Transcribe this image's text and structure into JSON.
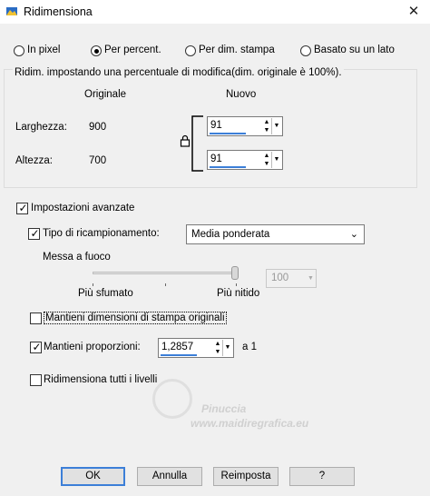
{
  "window": {
    "title": "Ridimensiona"
  },
  "modes": [
    {
      "label": "In pixel",
      "selected": false
    },
    {
      "label": "Per percent.",
      "selected": true
    },
    {
      "label": "Per dim. stampa",
      "selected": false
    },
    {
      "label": "Basato su un lato",
      "selected": false
    }
  ],
  "group": {
    "caption": "Ridim. impostando una percentuale di modifica(dim. originale è 100%).",
    "col_original": "Originale",
    "col_new": "Nuovo",
    "width_label": "Larghezza:",
    "width_original": "900",
    "width_new": "91",
    "height_label": "Altezza:",
    "height_original": "700",
    "height_new": "91"
  },
  "advanced": {
    "label": "Impostazioni avanzate",
    "checked": true,
    "resample_label": "Tipo di ricampionamento:",
    "resample_checked": true,
    "resample_value": "Media ponderata",
    "sharpen_label": "Messa a fuoco",
    "sharpen_left": "Più sfumato",
    "sharpen_right": "Più nitido",
    "sharpen_value": "100",
    "keep_print_label": "Mantieni dimensioni di stampa originali",
    "keep_print_checked": false,
    "keep_ratio_label": "Mantieni proporzioni:",
    "keep_ratio_checked": true,
    "ratio_value": "1,2857",
    "ratio_suffix": "a 1",
    "all_layers_label": "Ridimensiona tutti i livelli",
    "all_layers_checked": false
  },
  "watermark": {
    "line1": "Pinuccia",
    "line2": "www.maidiregrafica.eu"
  },
  "buttons": {
    "ok": "OK",
    "cancel": "Annulla",
    "reset": "Reimposta",
    "help": "?"
  },
  "colors": {
    "accent": "#3c7fd8",
    "background": "#f0f0f0"
  }
}
